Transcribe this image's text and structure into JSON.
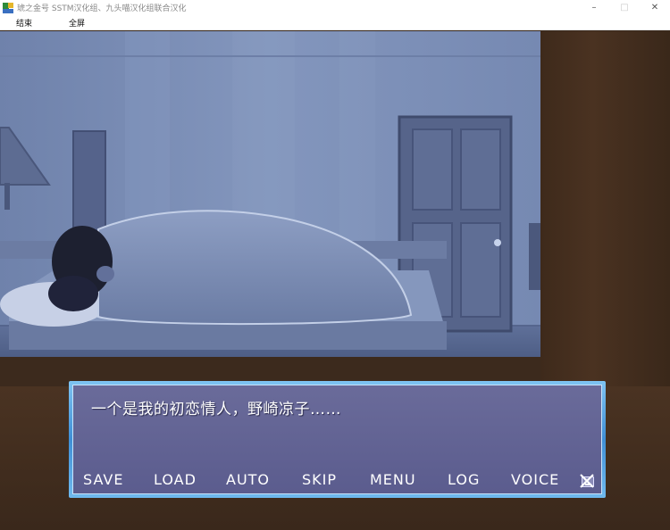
{
  "window": {
    "title": "琥之金号  SSTM汉化组、九头喵汉化组联合汉化",
    "controls": {
      "minimize": "–",
      "maximize": "□",
      "close": "✕"
    }
  },
  "menubar": {
    "items": [
      "结束",
      "全屏"
    ]
  },
  "dialog": {
    "text": "一个是我的初恋情人，野崎凉子……"
  },
  "controls": {
    "save": "SAVE",
    "load": "LOAD",
    "auto": "AUTO",
    "skip": "SKIP",
    "menu": "MENU",
    "log": "LOG",
    "voice": "VOICE",
    "close_icon": "close-icon"
  },
  "colors": {
    "dialog_fill": "#5f6092",
    "dialog_border": "#4a9ae0",
    "scene_tint": "#7d8fb5",
    "frame": "#3c2a1d"
  }
}
